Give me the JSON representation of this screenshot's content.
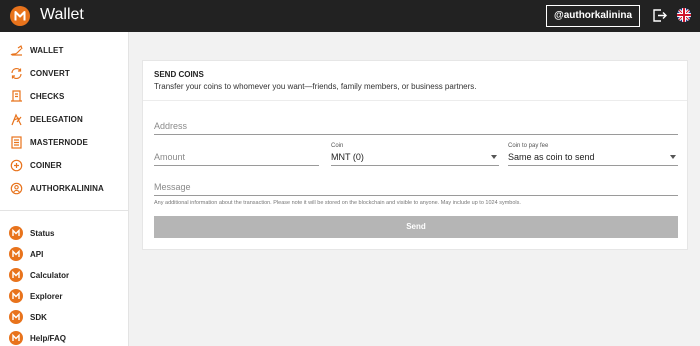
{
  "header": {
    "app_title": "Wallet",
    "user_button": "@authorkalinina",
    "brand_color": "#e8731c"
  },
  "sidebar": {
    "items": [
      {
        "label": "WALLET",
        "icon": "wallet-icon"
      },
      {
        "label": "CONVERT",
        "icon": "convert-icon"
      },
      {
        "label": "CHECKS",
        "icon": "checks-icon"
      },
      {
        "label": "DELEGATION",
        "icon": "delegation-icon"
      },
      {
        "label": "MASTERNODE",
        "icon": "masternode-icon"
      },
      {
        "label": "COINER",
        "icon": "coiner-icon"
      },
      {
        "label": "AUTHORKALININA",
        "icon": "user-icon"
      }
    ],
    "links": [
      {
        "label": "Status"
      },
      {
        "label": "API"
      },
      {
        "label": "Calculator"
      },
      {
        "label": "Explorer"
      },
      {
        "label": "SDK"
      },
      {
        "label": "Help/FAQ"
      }
    ]
  },
  "send_form": {
    "title": "SEND COINS",
    "subtitle": "Transfer your coins to whomever you want—friends, family members, or business partners.",
    "address_placeholder": "Address",
    "amount_placeholder": "Amount",
    "coin_label": "Coin",
    "coin_value": "MNT (0)",
    "fee_label": "Coin to pay fee",
    "fee_value": "Same as coin to send",
    "message_placeholder": "Message",
    "hint": "Any additional information about the transaction. Please note it will be stored on the blockchain and visible to anyone. May include up to 1024 symbols.",
    "send_label": "Send"
  }
}
